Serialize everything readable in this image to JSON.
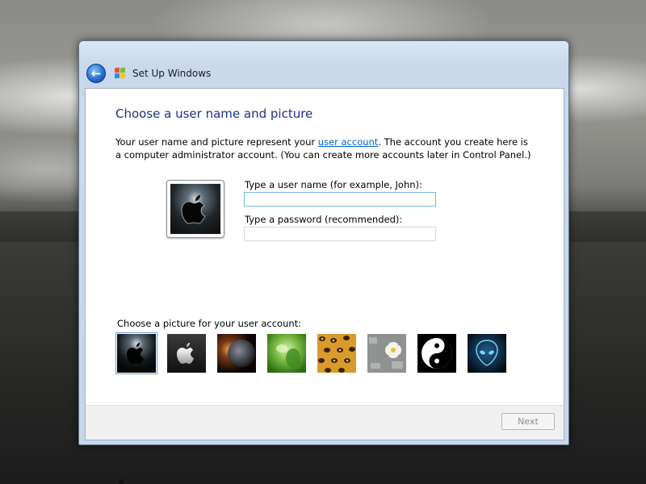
{
  "window": {
    "title": "Set Up Windows",
    "back_icon": "back-arrow-icon",
    "logo_icon": "windows-logo-icon"
  },
  "main": {
    "heading": "Choose a user name and picture",
    "intro_before_link": "Your user name and picture represent your ",
    "intro_link": "user account",
    "intro_after_link": ". The account you create here is a computer administrator account. (You can create more accounts later in Control Panel.)",
    "username_label": "Type a user name (for example, John):",
    "username_value": "",
    "password_label": "Type a password (recommended):",
    "password_value": "",
    "pictures_label": "Choose a picture for your user account:",
    "selected_picture_index": 0,
    "pictures": [
      {
        "name": "apple-dark-picture",
        "icon": "apple-logo-icon"
      },
      {
        "name": "apple-silver-picture",
        "icon": "apple-logo-icon"
      },
      {
        "name": "planet-picture",
        "icon": "planet-icon"
      },
      {
        "name": "green-leaf-picture",
        "icon": "leaf-icon"
      },
      {
        "name": "leopard-picture",
        "icon": "leopard-pattern-icon"
      },
      {
        "name": "flower-picture",
        "icon": "flower-icon"
      },
      {
        "name": "yin-yang-picture",
        "icon": "yin-yang-icon"
      },
      {
        "name": "alien-picture",
        "icon": "alien-icon"
      }
    ]
  },
  "footer": {
    "next_label": "Next"
  },
  "colors": {
    "heading": "#1e3287",
    "link": "#0066cc",
    "window_frame": "#c8d6e8"
  }
}
